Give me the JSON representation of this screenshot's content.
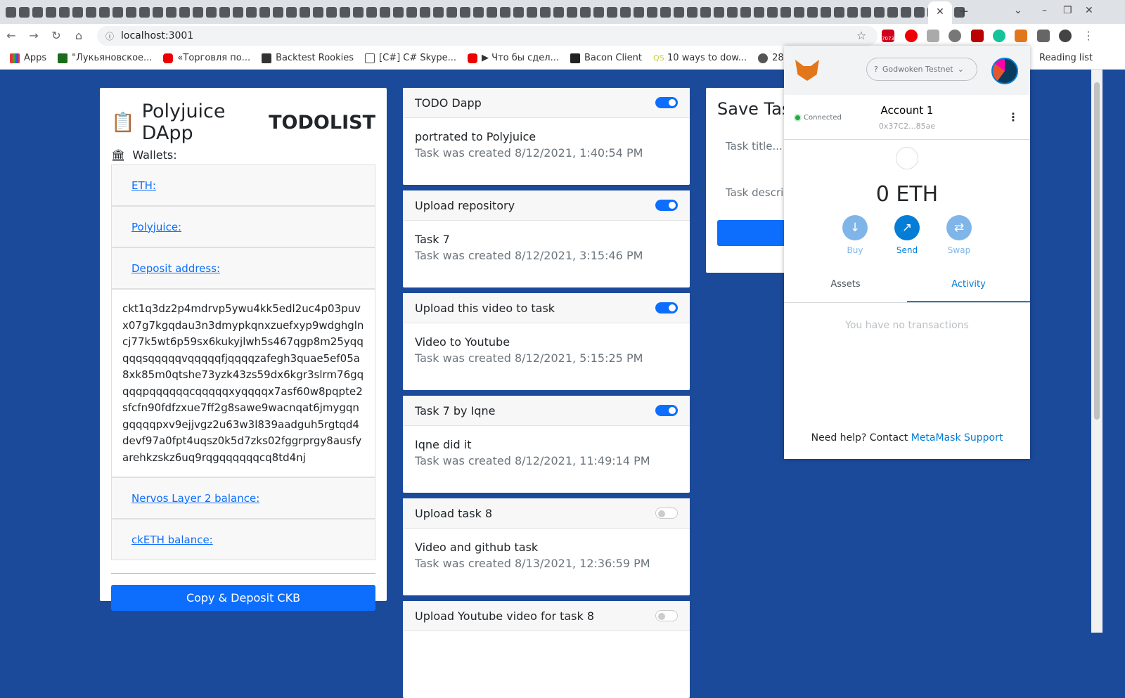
{
  "browser": {
    "url": "localhost:3001",
    "bookmarks": [
      "Apps",
      "\"Лукьяновское...",
      "«Торговля по...",
      "Backtest Rookies",
      "[C#] C# Skype...",
      "▶ Что бы сдел...",
      "Bacon Client",
      "10 ways to dow...",
      "28"
    ],
    "reading_list": "Reading list",
    "badge": "7073"
  },
  "left": {
    "title_prefix": "Polyjuice DApp",
    "title_bold": "TODOLIST",
    "wallets_label": "Wallets:",
    "eth": "ETH:",
    "polyjuice": "Polyjuice:",
    "deposit_label": "Deposit address:",
    "deposit_address": "ckt1q3dz2p4mdrvp5ywu4kk5edl2uc4p03puvx07g7kgqdau3n3dmypkqnxzuefxyp9wdghglncj77k5wt6p59sx6kukyjlwh5s467qgp8m25yqqqqqsqqqqqvqqqqqfjqqqqzafegh3quae5ef05a8xk85m0qtshe73yzk43zs59dx6kgr3slrm76gqqqqpqqqqqqcqqqqqxyqqqqx7asf60w8pqpte2sfcfn90fdfzxue7ff2g8sawe9wacnqat6jmygqngqqqqpxv9ejjvgz2u63w3l839aadguh5rgtqd4devf97a0fpt4uqsz0k5d7zks02fggrprgy8ausfyarehkzskz6uq9rqgqqqqqqcq8td4nj",
    "nervos_balance": "Nervos Layer 2 balance:",
    "cketh_balance": "ckETH balance:",
    "deposit_button": "Copy & Deposit CKB"
  },
  "tasks": [
    {
      "title": "TODO Dapp",
      "done": true,
      "name": "portrated to Polyjuice",
      "created": "Task was created 8/12/2021, 1:40:54 PM"
    },
    {
      "title": "Upload repository",
      "done": true,
      "name": "Task 7",
      "created": "Task was created 8/12/2021, 3:15:46 PM"
    },
    {
      "title": "Upload this video to task",
      "done": true,
      "name": "Video to Youtube",
      "created": "Task was created 8/12/2021, 5:15:25 PM"
    },
    {
      "title": "Task 7 by Iqne",
      "done": true,
      "name": "Iqne did it",
      "created": "Task was created 8/12/2021, 11:49:14 PM"
    },
    {
      "title": "Upload task 8",
      "done": false,
      "name": "Video and github task",
      "created": "Task was created 8/13/2021, 12:36:59 PM"
    },
    {
      "title": "Upload Youtube video for task 8",
      "done": false,
      "name": "",
      "created": ""
    }
  ],
  "save": {
    "title": "Save Task",
    "title_placeholder": "Task title...",
    "desc_placeholder": "Task description..."
  },
  "metamask": {
    "network": "Godwoken Testnet",
    "status": "Connected",
    "account": "Account 1",
    "address": "0x37C2...85ae",
    "balance": "0 ETH",
    "actions": [
      "Buy",
      "Send",
      "Swap"
    ],
    "tabs": [
      "Assets",
      "Activity"
    ],
    "active_tab": "Activity",
    "empty": "You have no transactions",
    "help_prefix": "Need help? Contact",
    "help_link": "MetaMask Support",
    "accent": "#037dd6"
  }
}
